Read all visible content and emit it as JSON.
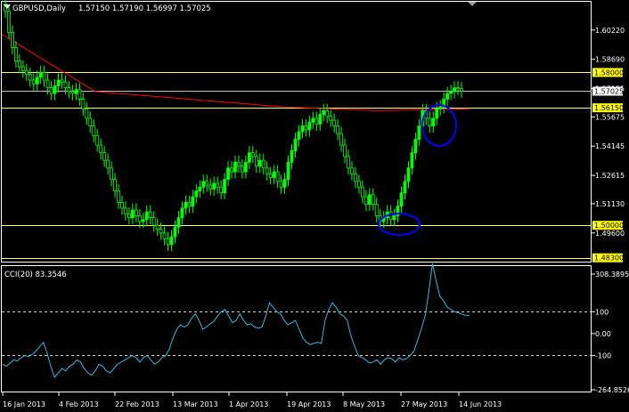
{
  "header": {
    "symbol": "GBPUSD,Daily",
    "ohlc": "1.57150 1.57190 1.56997 1.57025"
  },
  "cci": {
    "label": "CCI(20) 83.3546"
  },
  "colors": {
    "background": "#000000",
    "frame": "#ffffff",
    "candle": "#00ff00",
    "ma": "#ff0000",
    "level": "#ffff66",
    "level_tag": "#ffff00",
    "circle": "#0000ff",
    "cci": "#3fb6d8"
  },
  "icons": {
    "scroll_marker": "triangle-down-icon",
    "corner": "triangle-down-icon"
  },
  "chart_data": [
    {
      "type": "candlestick",
      "y_ticks": [
        "1.60220",
        "1.58690",
        "1.57155",
        "1.55675",
        "1.54145",
        "1.52615",
        "1.51130",
        "1.49600"
      ],
      "ylim": [
        1.481,
        1.617
      ],
      "x_labels": [
        "16 Jan 2013",
        "4 Feb 2013",
        "22 Feb 2013",
        "13 Mar 2013",
        "1 Apr 2013",
        "19 Apr 2013",
        "8 May 2013",
        "27 May 2013",
        "14 Jun 2013"
      ],
      "current_price": "1.57025",
      "levels": [
        {
          "value": 1.58,
          "label": "1.58000"
        },
        {
          "value": 1.5615,
          "label": "1.56150"
        },
        {
          "value": 1.5,
          "label": "1.50000"
        },
        {
          "value": 1.483,
          "label": "1.48300"
        }
      ],
      "close": [
        1.612,
        1.601,
        1.593,
        1.586,
        1.583,
        1.581,
        1.579,
        1.576,
        1.574,
        1.5775,
        1.58,
        1.576,
        1.572,
        1.569,
        1.573,
        1.576,
        1.575,
        1.572,
        1.57,
        1.569,
        1.571,
        1.566,
        1.561,
        1.556,
        1.552,
        1.547,
        1.542,
        1.538,
        1.534,
        1.53,
        1.524,
        1.518,
        1.512,
        1.509,
        1.506,
        1.504,
        1.508,
        1.505,
        1.502,
        1.503,
        1.507,
        1.504,
        1.5,
        1.498,
        1.496,
        1.493,
        1.49,
        1.494,
        1.499,
        1.504,
        1.509,
        1.512,
        1.51,
        1.515,
        1.518,
        1.52,
        1.523,
        1.521,
        1.519,
        1.522,
        1.52,
        1.517,
        1.524,
        1.53,
        1.528,
        1.533,
        1.531,
        1.528,
        1.533,
        1.538,
        1.536,
        1.531,
        1.534,
        1.53,
        1.527,
        1.525,
        1.528,
        1.523,
        1.52,
        1.524,
        1.533,
        1.539,
        1.545,
        1.549,
        1.552,
        1.55,
        1.554,
        1.556,
        1.553,
        1.558,
        1.56,
        1.557,
        1.555,
        1.552,
        1.548,
        1.542,
        1.536,
        1.53,
        1.527,
        1.523,
        1.52,
        1.515,
        1.511,
        1.516,
        1.511,
        1.505,
        1.502,
        1.504,
        1.507,
        1.503,
        1.505,
        1.51,
        1.517,
        1.523,
        1.53,
        1.538,
        1.545,
        1.552,
        1.56,
        1.556,
        1.552,
        1.556,
        1.561,
        1.562,
        1.566,
        1.569,
        1.57,
        1.572,
        1.5715,
        1.57025
      ],
      "ma": [
        1.6,
        1.57,
        1.566,
        1.562,
        1.56,
        1.561
      ]
    },
    {
      "type": "line",
      "title": "CCI(20) 83.3546",
      "y_ticks": [
        "308.3895",
        "100",
        "0.00",
        "-100",
        "-264.8526"
      ],
      "ylim": [
        -264.8526,
        308.3895
      ],
      "values": [
        -140,
        -150,
        -135,
        -120,
        -125,
        -110,
        -100,
        -105,
        -95,
        -80,
        -60,
        -40,
        -90,
        -150,
        -200,
        -180,
        -160,
        -170,
        -150,
        -140,
        -120,
        -130,
        -160,
        -180,
        -190,
        -170,
        -140,
        -150,
        -170,
        -180,
        -160,
        -140,
        -130,
        -120,
        -110,
        -100,
        -110,
        -130,
        -110,
        -100,
        -120,
        -140,
        -130,
        -110,
        -100,
        -70,
        -20,
        20,
        40,
        30,
        40,
        70,
        90,
        60,
        20,
        30,
        45,
        55,
        80,
        100,
        110,
        80,
        50,
        60,
        90,
        60,
        40,
        45,
        30,
        25,
        30,
        80,
        140,
        120,
        100,
        90,
        60,
        40,
        50,
        60,
        20,
        -20,
        -40,
        -50,
        -45,
        -40,
        -45,
        60,
        110,
        140,
        120,
        90,
        80,
        60,
        -10,
        -60,
        -100,
        -110,
        -120,
        -135,
        -130,
        -120,
        -140,
        -120,
        -110,
        -115,
        -130,
        -110,
        -120,
        -115,
        -100,
        -80,
        -30,
        20,
        80,
        190,
        320,
        240,
        170,
        150,
        120,
        110,
        100,
        95,
        88,
        84,
        83
      ]
    }
  ]
}
